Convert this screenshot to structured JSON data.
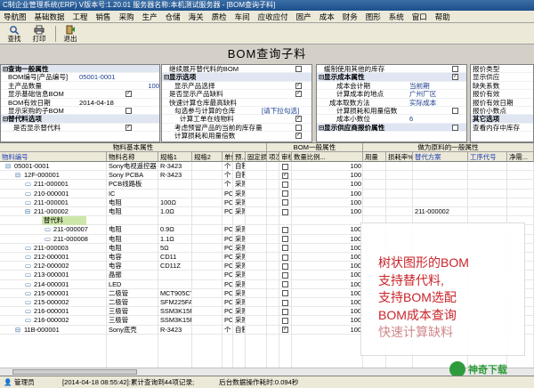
{
  "app": {
    "title": "C制企业管理系统(ERP) V版本号:1.20.01 服务器名称:本机测试服务器 - [BOM查询子料]"
  },
  "menu": [
    "导航图",
    "基础数据",
    "工程",
    "销售",
    "采购",
    "生产",
    "仓储",
    "海关",
    "质检",
    "车间",
    "应收应付",
    "固产",
    "成本",
    "财务",
    "图形",
    "系统",
    "窗口",
    "帮助"
  ],
  "toolbar": {
    "find": "查找",
    "print": "打印",
    "exit": "退出"
  },
  "page": {
    "title": "BOM查询子料"
  },
  "panel1": {
    "header": "查询一般属性",
    "bom_no_label": "BOM编号[产品编号]",
    "bom_no_value": "05001-0001",
    "qty_label": "主产品数量",
    "qty_value": "100",
    "show_base_label": "显示基础信息BOM",
    "bom_date_label": "BOM有效日期",
    "bom_date_value": "2014-04-18",
    "show_buy_label": "显示采购的子BOM",
    "alt_header": "替代料选项",
    "show_alt_label": "是否显示替代料"
  },
  "panel2": {
    "row1": "继续展开替代料的BOM",
    "row2": "显示选项",
    "row3": "显示产品选择",
    "row4": "是否显示产品缺料",
    "row5": "快速计算仓库最高缺料",
    "row6": "勾选参与计算的仓库",
    "row6_value": "[请下拉勾选]",
    "row7": "计算工单在线物料",
    "row8": "考虑预留产品的当前的库存量",
    "row9": "计算损耗和用量倍数"
  },
  "panel3": {
    "row1": "缓制使用其他的库存",
    "row2": "显示成本属性",
    "row3": "成本会计期",
    "row3_value": "当前期",
    "row4": "计算成本的地点",
    "row4_value": "广州厂区",
    "row5": "成本取数方法",
    "row5_value": "实际成本",
    "row6": "计算损耗和用量倍数",
    "row7": "成本小数位",
    "row7_value": "6",
    "row8": "显示供应商报价属性"
  },
  "panel4": {
    "row1": "报价类型",
    "row2": "显示供应",
    "row3": "缺失系数",
    "row4": "报价有效",
    "row5": "报价有效日期",
    "row6": "报价小数点",
    "row7": "其它选项",
    "row8": "查看内存中库存"
  },
  "grid": {
    "group1": "物料基本属性",
    "group2": "BOM一般属性",
    "group3": "做为原料的一般属性",
    "columns": [
      "物料编号",
      "物料名称",
      "规格1",
      "规格2",
      "单位",
      "预...",
      "固定损耗量",
      "项次",
      "审核",
      "数量比例...",
      "用量",
      "损耗率%",
      "替代方案",
      "工序代号",
      "净需..."
    ],
    "rows": [
      {
        "code": "05001-0001",
        "name": "Sony电视遥控器",
        "spec": "R-3423",
        "unit": "个",
        "make": "自制",
        "item": "",
        "check": false,
        "ratio": "100",
        "qty": ""
      },
      {
        "code": "12F-000001",
        "name": "Sony PCBA",
        "spec": "R-3423",
        "unit": "个",
        "make": "自制",
        "item": "",
        "check": true,
        "ratio": "100",
        "qty": ""
      },
      {
        "code": "211-000001",
        "name": "PCB线路板",
        "spec": "",
        "unit": "个",
        "make": "采购",
        "item": "",
        "check": false,
        "ratio": "100",
        "qty": ""
      },
      {
        "code": "210-000001",
        "name": "IC",
        "spec": "",
        "unit": "PC",
        "make": "采购",
        "item": "",
        "check": false,
        "ratio": "100",
        "qty": ""
      },
      {
        "code": "211-000001",
        "name": "电阻",
        "spec": "100Ω",
        "unit": "PC",
        "make": "采购",
        "item": "",
        "check": false,
        "ratio": "100",
        "qty": ""
      },
      {
        "code": "211-000002",
        "name": "电阻",
        "spec": "1.0Ω",
        "unit": "PC",
        "make": "采购",
        "item": "",
        "check": false,
        "ratio": "100",
        "qty": "211-000002"
      },
      {
        "code": "替代料",
        "name": "",
        "spec": "",
        "unit": "",
        "make": "",
        "item": "",
        "check": false,
        "ratio": "",
        "qty": ""
      },
      {
        "code": "211-000007",
        "name": "电阻",
        "spec": "0.9Ω",
        "unit": "PC",
        "make": "采购",
        "item": "",
        "check": false,
        "ratio": "100",
        "qty": ""
      },
      {
        "code": "211-000008",
        "name": "电阻",
        "spec": "1.1Ω",
        "unit": "PC",
        "make": "采购",
        "item": "",
        "check": false,
        "ratio": "100",
        "qty": ""
      },
      {
        "code": "211-000003",
        "name": "电阻",
        "spec": "5Ω",
        "unit": "PC",
        "make": "采购",
        "item": "",
        "check": false,
        "ratio": "100",
        "qty": ""
      },
      {
        "code": "212-000001",
        "name": "电容",
        "spec": "CD11",
        "unit": "PC",
        "make": "采购",
        "item": "",
        "check": false,
        "ratio": "100",
        "qty": ""
      },
      {
        "code": "212-000002",
        "name": "电容",
        "spec": "CD11Z",
        "unit": "PC",
        "make": "采购",
        "item": "",
        "check": false,
        "ratio": "100",
        "qty": ""
      },
      {
        "code": "213-000001",
        "name": "晶振",
        "spec": "",
        "unit": "PC",
        "make": "采购",
        "item": "",
        "check": false,
        "ratio": "100",
        "qty": ""
      },
      {
        "code": "214-000001",
        "name": "LED",
        "spec": "",
        "unit": "PC",
        "make": "采购",
        "item": "",
        "check": false,
        "ratio": "100",
        "qty": ""
      },
      {
        "code": "215-000001",
        "name": "二极管",
        "spec": "MCT905CT",
        "unit": "PC",
        "make": "采购",
        "item": "",
        "check": false,
        "ratio": "100",
        "qty": ""
      },
      {
        "code": "215-000002",
        "name": "二极管",
        "spec": "SFM225FA",
        "unit": "PC",
        "make": "采购",
        "item": "",
        "check": false,
        "ratio": "100",
        "qty": ""
      },
      {
        "code": "216-000001",
        "name": "三极管",
        "spec": "SSM3K15FS",
        "unit": "PC",
        "make": "采购",
        "item": "",
        "check": false,
        "ratio": "100",
        "qty": ""
      },
      {
        "code": "216-000002",
        "name": "三极管",
        "spec": "SSM3K15FS",
        "unit": "PC",
        "make": "采购",
        "item": "",
        "check": false,
        "ratio": "100",
        "qty": ""
      },
      {
        "code": "11B-000001",
        "name": "Sony底壳",
        "spec": "R-3423",
        "unit": "个",
        "make": "自制",
        "item": "",
        "check": true,
        "ratio": "100",
        "qty": ""
      }
    ]
  },
  "overlay": {
    "lines": [
      "树状图形的BOM",
      "支持替代料,",
      "支持BOM选配",
      "BOM成本查询",
      "快速计算缺料"
    ],
    "logo_text": "神奇下载"
  },
  "status": {
    "user": "管理员",
    "message": "[2014-04-18 08:55:42]:累计查询到44项记录;",
    "message2": "后台数据操作耗时:0.094秒"
  }
}
